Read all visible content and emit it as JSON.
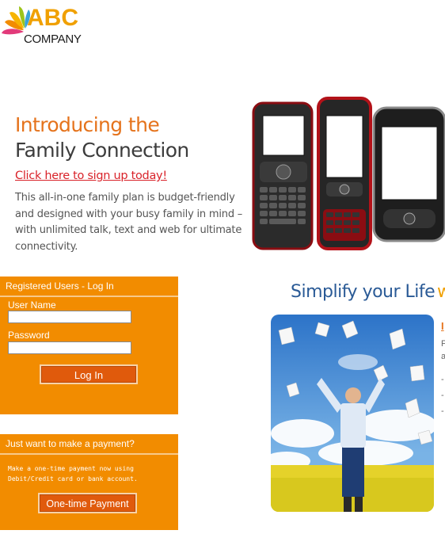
{
  "logo": {
    "line1": "ABC",
    "line2": "COMPANY"
  },
  "promo": {
    "title_line1": "Introducing the",
    "title_line2": "Family Connection",
    "signup_link": "Click here to sign up today!",
    "description": "This all-in-one family plan is budget-friendly and designed with your busy family in mind – with unlimited talk, text and web for ultimate connectivity."
  },
  "login": {
    "header": "Registered Users - Log In",
    "username_label": "User Name",
    "username_value": "",
    "password_label": "Password",
    "password_value": "",
    "button": "Log In"
  },
  "payment": {
    "header": "Just want to make a payment?",
    "desc_line1": "Make a one-time payment now using",
    "desc_line2": "Debit/Credit card or bank account.",
    "button": "One-time Payment"
  },
  "simplify": {
    "text": "Simplify your Life",
    "cut": "w"
  },
  "cropped": {
    "l1": "I",
    "l2": "F",
    "l3": "a",
    "l4": "-",
    "l5": "-",
    "l6": "-"
  },
  "colors": {
    "orange": "#f28c00",
    "button": "#e05a0c",
    "accent": "#e5731c",
    "link": "#d9232a",
    "blue": "#2a5a96"
  }
}
